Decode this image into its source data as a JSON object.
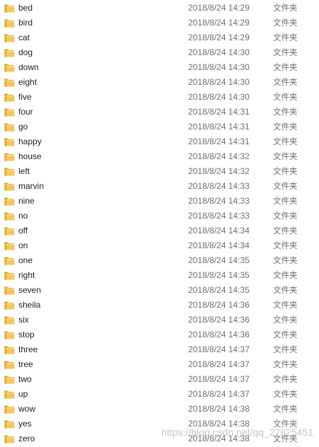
{
  "files": [
    {
      "name": "bed",
      "date": "2018/8/24 14:29",
      "type": "文件夹"
    },
    {
      "name": "bird",
      "date": "2018/8/24 14:29",
      "type": "文件夹"
    },
    {
      "name": "cat",
      "date": "2018/8/24 14:29",
      "type": "文件夹"
    },
    {
      "name": "dog",
      "date": "2018/8/24 14:30",
      "type": "文件夹"
    },
    {
      "name": "down",
      "date": "2018/8/24 14:30",
      "type": "文件夹"
    },
    {
      "name": "eight",
      "date": "2018/8/24 14:30",
      "type": "文件夹"
    },
    {
      "name": "five",
      "date": "2018/8/24 14:30",
      "type": "文件夹"
    },
    {
      "name": "four",
      "date": "2018/8/24 14:31",
      "type": "文件夹"
    },
    {
      "name": "go",
      "date": "2018/8/24 14:31",
      "type": "文件夹"
    },
    {
      "name": "happy",
      "date": "2018/8/24 14:31",
      "type": "文件夹"
    },
    {
      "name": "house",
      "date": "2018/8/24 14:32",
      "type": "文件夹"
    },
    {
      "name": "left",
      "date": "2018/8/24 14:32",
      "type": "文件夹"
    },
    {
      "name": "marvin",
      "date": "2018/8/24 14:33",
      "type": "文件夹"
    },
    {
      "name": "nine",
      "date": "2018/8/24 14:33",
      "type": "文件夹"
    },
    {
      "name": "no",
      "date": "2018/8/24 14:33",
      "type": "文件夹"
    },
    {
      "name": "off",
      "date": "2018/8/24 14:34",
      "type": "文件夹"
    },
    {
      "name": "on",
      "date": "2018/8/24 14:34",
      "type": "文件夹"
    },
    {
      "name": "one",
      "date": "2018/8/24 14:35",
      "type": "文件夹"
    },
    {
      "name": "right",
      "date": "2018/8/24 14:35",
      "type": "文件夹"
    },
    {
      "name": "seven",
      "date": "2018/8/24 14:35",
      "type": "文件夹"
    },
    {
      "name": "sheila",
      "date": "2018/8/24 14:36",
      "type": "文件夹"
    },
    {
      "name": "six",
      "date": "2018/8/24 14:36",
      "type": "文件夹"
    },
    {
      "name": "stop",
      "date": "2018/8/24 14:36",
      "type": "文件夹"
    },
    {
      "name": "three",
      "date": "2018/8/24 14:37",
      "type": "文件夹"
    },
    {
      "name": "tree",
      "date": "2018/8/24 14:37",
      "type": "文件夹"
    },
    {
      "name": "two",
      "date": "2018/8/24 14:37",
      "type": "文件夹"
    },
    {
      "name": "up",
      "date": "2018/8/24 14:37",
      "type": "文件夹"
    },
    {
      "name": "wow",
      "date": "2018/8/24 14:38",
      "type": "文件夹"
    },
    {
      "name": "yes",
      "date": "2018/8/24 14:38",
      "type": "文件夹"
    },
    {
      "name": "zero",
      "date": "2018/8/24 14:38",
      "type": "文件夹"
    }
  ],
  "icons": {
    "folder": "folder-icon"
  },
  "colors": {
    "folder_body": "#f3c75a",
    "folder_tab": "#e8b13e",
    "name_text": "#1e1e1e",
    "meta_text": "#6d6d6d"
  },
  "watermark": "https://blog.csdn.net/qq_27825451"
}
